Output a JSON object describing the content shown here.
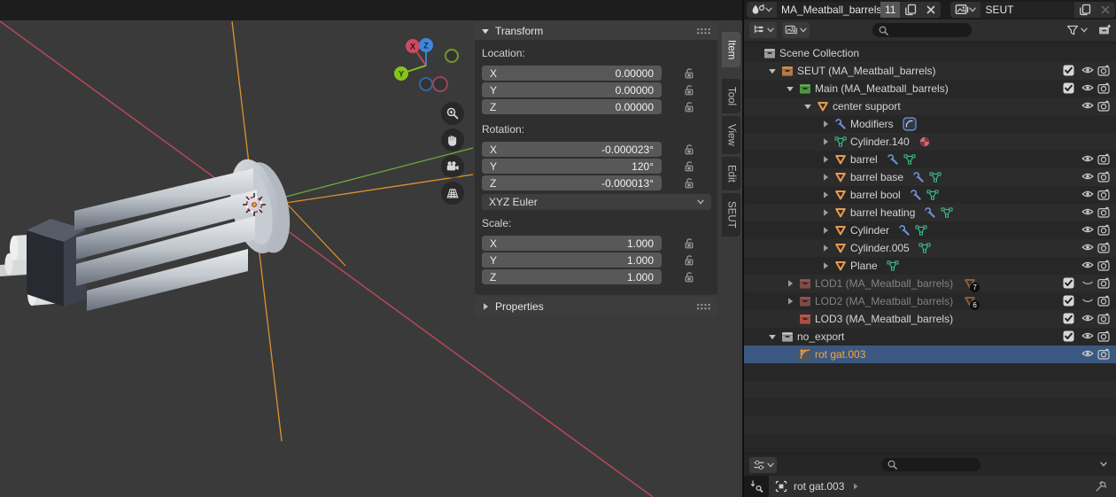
{
  "header": {
    "id_icon": "physics-icon",
    "id_name": "MA_Meatball_barrels",
    "id_users": "11",
    "preset_icon": "image-icon",
    "preset_name": "SEUT"
  },
  "viewport": {
    "gizmo": {
      "x_label": "X",
      "y_label": "Y",
      "z_label": "Z"
    },
    "tools": [
      {
        "name": "zoom-icon"
      },
      {
        "name": "pan-hand-icon"
      },
      {
        "name": "camera-view-icon"
      },
      {
        "name": "toggle-grid-icon"
      }
    ],
    "colors": {
      "axis_red": "#b8475c",
      "axis_orange": "#e0912f",
      "axis_green": "#6faa3a"
    }
  },
  "npanel": {
    "transform_title": "Transform",
    "properties_title": "Properties",
    "tabs": [
      {
        "label": "Item",
        "active": true
      },
      {
        "label": "Tool",
        "active": false
      },
      {
        "label": "View",
        "active": false
      },
      {
        "label": "Edit",
        "active": false
      },
      {
        "label": "SEUT",
        "active": false
      }
    ],
    "sections": [
      {
        "label": "Location:",
        "fields": [
          {
            "axis": "X",
            "value": "0.00000"
          },
          {
            "axis": "Y",
            "value": "0.00000"
          },
          {
            "axis": "Z",
            "value": "0.00000"
          }
        ]
      },
      {
        "label": "Rotation:",
        "fields": [
          {
            "axis": "X",
            "value": "-0.000023°"
          },
          {
            "axis": "Y",
            "value": "120°"
          },
          {
            "axis": "Z",
            "value": "-0.000013°"
          }
        ],
        "mode": "XYZ Euler"
      },
      {
        "label": "Scale:",
        "fields": [
          {
            "axis": "X",
            "value": "1.000"
          },
          {
            "axis": "Y",
            "value": "1.000"
          },
          {
            "axis": "Z",
            "value": "1.000"
          }
        ]
      }
    ]
  },
  "outliner": {
    "rows": [
      {
        "indent": 0,
        "expander": "",
        "icon": "collection-icon",
        "color": "#c9c9c9",
        "label": "Scene Collection",
        "extras": [],
        "right": []
      },
      {
        "indent": 1,
        "expander": "open",
        "icon": "collection-icon",
        "color": "#e79a4c",
        "label": "SEUT (MA_Meatball_barrels)",
        "extras": [],
        "right": [
          "check",
          "eye",
          "cam"
        ]
      },
      {
        "indent": 2,
        "expander": "open",
        "icon": "collection-icon",
        "color": "#5fbf4e",
        "label": "Main (MA_Meatball_barrels)",
        "extras": [],
        "right": [
          "check",
          "eye",
          "cam"
        ]
      },
      {
        "indent": 3,
        "expander": "open",
        "icon": "mesh-object-icon",
        "color": "#e79a4c",
        "label": "center support",
        "extras": [],
        "right": [
          "eye",
          "cam"
        ]
      },
      {
        "indent": 4,
        "expander": "closed",
        "icon": "wrench-icon",
        "color": "#6f8fd8",
        "label": "Modifiers",
        "extras": [
          "bevel-modifier-icon"
        ],
        "right": []
      },
      {
        "indent": 4,
        "expander": "closed",
        "icon": "mesh-data-icon",
        "color": "#3fbf8f",
        "label": "Cylinder.140",
        "extras": [
          "material-icon"
        ],
        "right": []
      },
      {
        "indent": 4,
        "expander": "closed",
        "icon": "mesh-object-icon",
        "color": "#e79a4c",
        "label": "barrel",
        "extras": [
          "wrench-icon",
          "mesh-data-icon"
        ],
        "right": [
          "eye",
          "cam"
        ]
      },
      {
        "indent": 4,
        "expander": "closed",
        "icon": "mesh-object-icon",
        "color": "#e79a4c",
        "label": "barrel base",
        "extras": [
          "wrench-icon",
          "mesh-data-icon"
        ],
        "right": [
          "eye",
          "cam"
        ]
      },
      {
        "indent": 4,
        "expander": "closed",
        "icon": "mesh-object-icon",
        "color": "#e79a4c",
        "label": "barrel bool",
        "extras": [
          "wrench-icon",
          "mesh-data-icon"
        ],
        "right": [
          "eye",
          "cam"
        ]
      },
      {
        "indent": 4,
        "expander": "closed",
        "icon": "mesh-object-icon",
        "color": "#e79a4c",
        "label": "barrel heating",
        "extras": [
          "wrench-icon",
          "mesh-data-icon"
        ],
        "right": [
          "eye",
          "cam"
        ]
      },
      {
        "indent": 4,
        "expander": "closed",
        "icon": "mesh-object-icon",
        "color": "#e79a4c",
        "label": "Cylinder",
        "extras": [
          "wrench-icon",
          "mesh-data-icon"
        ],
        "right": [
          "eye",
          "cam"
        ]
      },
      {
        "indent": 4,
        "expander": "closed",
        "icon": "mesh-object-icon",
        "color": "#e79a4c",
        "label": "Cylinder.005",
        "extras": [
          "mesh-data-icon"
        ],
        "right": [
          "eye",
          "cam"
        ]
      },
      {
        "indent": 4,
        "expander": "closed",
        "icon": "mesh-object-icon",
        "color": "#e79a4c",
        "label": "Plane",
        "extras": [
          "mesh-data-icon"
        ],
        "right": [
          "eye",
          "cam"
        ]
      },
      {
        "indent": 2,
        "expander": "closed",
        "icon": "collection-icon",
        "color": "#a05a50",
        "label": "LOD1 (MA_Meatball_barrels)",
        "dim": true,
        "badge": "7",
        "extras": [],
        "right": [
          "check",
          "eyeClosed",
          "cam"
        ]
      },
      {
        "indent": 2,
        "expander": "closed",
        "icon": "collection-icon",
        "color": "#a05a50",
        "label": "LOD2 (MA_Meatball_barrels)",
        "dim": true,
        "badge": "6",
        "extras": [],
        "right": [
          "check",
          "eyeClosed",
          "cam"
        ]
      },
      {
        "indent": 2,
        "expander": "",
        "icon": "collection-icon",
        "color": "#d95b4e",
        "label": "LOD3 (MA_Meatball_barrels)",
        "extras": [],
        "right": [
          "check",
          "eye",
          "cam"
        ]
      },
      {
        "indent": 1,
        "expander": "open",
        "icon": "collection-icon",
        "color": "#d0d0d0",
        "label": "no_export",
        "extras": [],
        "right": [
          "check",
          "eye",
          "cam"
        ]
      },
      {
        "indent": 2,
        "expander": "",
        "icon": "empty-axes-icon",
        "color": "#e79a4c",
        "chip": true,
        "label": "rot gat.003",
        "selected": true,
        "active": true,
        "extras": [],
        "right": [
          "eye",
          "cam"
        ]
      }
    ]
  },
  "properties_editor": {
    "breadcrumb": "rot gat.003"
  },
  "colors": {
    "selection_blue": "#3b5880",
    "active_orange": "#f4a83c",
    "collection_orange": "#e79a4c",
    "collection_green": "#5fbf4e",
    "collection_red": "#d95b4e",
    "mesh_data_green": "#3fbf8f",
    "modifier_blue": "#6f8fd8"
  }
}
